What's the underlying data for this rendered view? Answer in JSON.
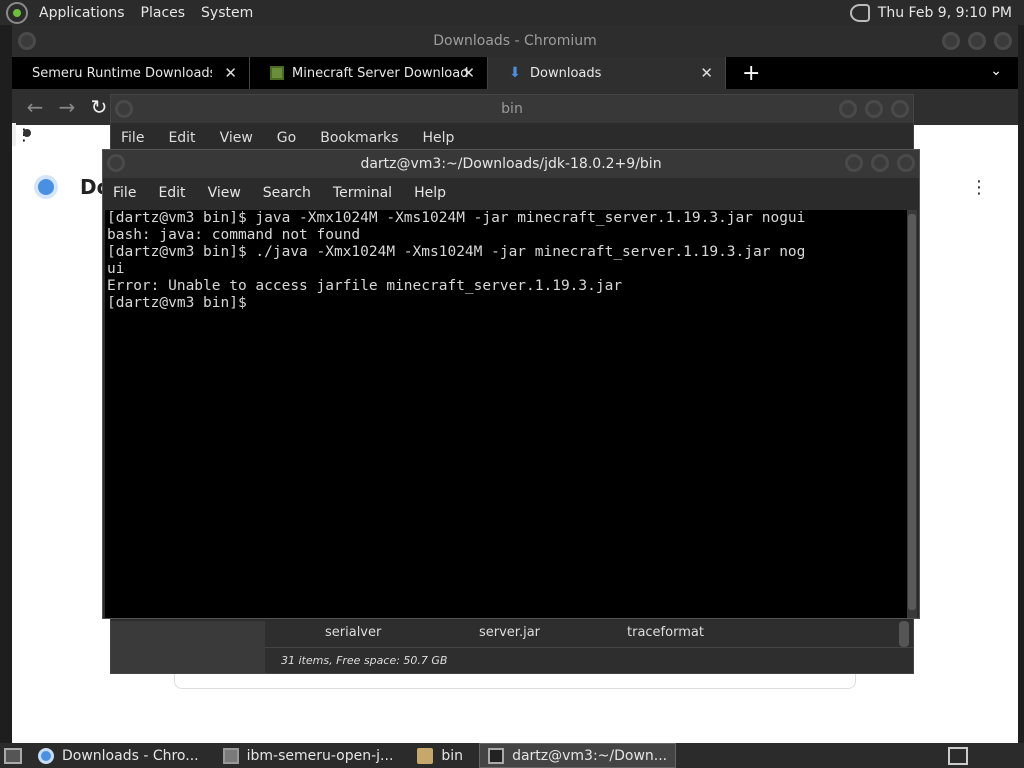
{
  "top_panel": {
    "menus": [
      "Applications",
      "Places",
      "System"
    ],
    "clock": "Thu Feb  9,  9:10 PM"
  },
  "chromium": {
    "title": "Downloads - Chromium",
    "tabs": [
      {
        "label": "Semeru Runtime Downloads – ",
        "icon": "ibm-icon"
      },
      {
        "label": "Minecraft Server Download | M",
        "icon": "minecraft-icon"
      },
      {
        "label": "Downloads",
        "icon": "download-icon",
        "active": true
      }
    ],
    "page_title": "Do"
  },
  "file_manager": {
    "title": "bin",
    "menus": [
      "File",
      "Edit",
      "View",
      "Go",
      "Bookmarks",
      "Help"
    ],
    "files": [
      "serialver",
      "server.jar",
      "traceformat"
    ],
    "status": "31 items, Free space: 50.7 GB"
  },
  "terminal": {
    "title": "dartz@vm3:~/Downloads/jdk-18.0.2+9/bin",
    "menus": [
      "File",
      "Edit",
      "View",
      "Search",
      "Terminal",
      "Help"
    ],
    "lines": [
      "[dartz@vm3 bin]$ java -Xmx1024M -Xms1024M -jar minecraft_server.1.19.3.jar nogui",
      "bash: java: command not found",
      "[dartz@vm3 bin]$ ./java -Xmx1024M -Xms1024M -jar minecraft_server.1.19.3.jar nog",
      "ui",
      "Error: Unable to access jarfile minecraft_server.1.19.3.jar",
      "[dartz@vm3 bin]$ "
    ]
  },
  "taskbar": {
    "tasks": [
      {
        "label": "Downloads - Chro...",
        "icon": "chromium-icon"
      },
      {
        "label": "ibm-semeru-open-j...",
        "icon": "archive-icon"
      },
      {
        "label": "bin",
        "icon": "folder-icon"
      },
      {
        "label": "dartz@vm3:~/Down...",
        "icon": "terminal-icon",
        "active": true
      }
    ]
  }
}
